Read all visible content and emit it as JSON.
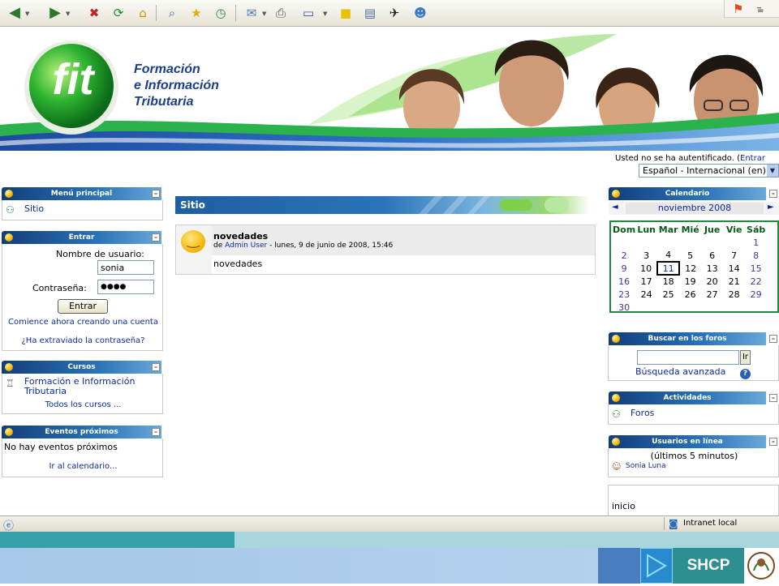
{
  "toolbar": {
    "icons": [
      "back-icon",
      "forward-icon",
      "stop-icon",
      "refresh-icon",
      "home-icon",
      "search-icon",
      "favorites-icon",
      "history-icon",
      "mail-icon",
      "print-icon",
      "edit-icon",
      "discuss-icon",
      "research-icon",
      "messenger-icon",
      "bluetooth-icon"
    ]
  },
  "banner": {
    "logo_text": "fit",
    "title_lines": [
      "Formación",
      "e Información",
      "Tributaria"
    ]
  },
  "header": {
    "auth_text": "Usted no se ha autentificado. (",
    "auth_link": "Entrar",
    "language": "Español - Internacional (en)"
  },
  "blocks": {
    "menu": {
      "title": "Menú principal",
      "item": "Sitio"
    },
    "login": {
      "title": "Entrar",
      "username_label": "Nombre de usuario:",
      "username_value": "sonia",
      "password_label": "Contraseña:",
      "password_value": "●●●●",
      "submit": "Entrar",
      "signup": "Comience ahora creando una cuenta",
      "forgot": "¿Ha extraviado la contraseña?"
    },
    "courses": {
      "title": "Cursos",
      "course": "Formación e Información Tributaria",
      "all": "Todos los cursos ..."
    },
    "events": {
      "title": "Eventos próximos",
      "none": "No hay eventos próximos",
      "calendar_link": "Ir al calendario..."
    }
  },
  "main": {
    "section_title": "Sitio",
    "post": {
      "subject": "novedades",
      "by_prefix": "de",
      "author": "Admin User",
      "date": "- lunes, 9 de junio de 2008, 15:46",
      "body": "novedades"
    }
  },
  "calendar": {
    "title": "Calendario",
    "prev": "◄",
    "next": "►",
    "month": "noviembre 2008",
    "days": [
      "Dom",
      "Lun",
      "Mar",
      "Mié",
      "Jue",
      "Vie",
      "Sáb"
    ],
    "weeks": [
      [
        "",
        "",
        "",
        "",
        "",
        "",
        "1"
      ],
      [
        "2",
        "3",
        "4",
        "5",
        "6",
        "7",
        "8"
      ],
      [
        "9",
        "10",
        "11",
        "12",
        "13",
        "14",
        "15"
      ],
      [
        "16",
        "17",
        "18",
        "19",
        "20",
        "21",
        "22"
      ],
      [
        "23",
        "24",
        "25",
        "26",
        "27",
        "28",
        "29"
      ],
      [
        "30",
        "",
        "",
        "",
        "",
        "",
        ""
      ]
    ],
    "today": "11"
  },
  "forum_search": {
    "title": "Buscar en los foros",
    "go": "Ir",
    "advanced": "Búsqueda avanzada"
  },
  "activities": {
    "title": "Actividades",
    "item": "Foros"
  },
  "online_users": {
    "title": "Usuarios en línea",
    "subtitle": "(últimos 5 minutos)",
    "user": "Sonia Luna"
  },
  "footer_block": {
    "text": "inicio"
  },
  "status_bar": {
    "zone": "Intranet local"
  },
  "taskbar": {
    "brand": "SHCP"
  },
  "colors": {
    "accent_green": "#2bb24c",
    "block_blue": "#1e5fa0",
    "link": "#0b2b9c",
    "calendar_border": "#1e8a3a"
  }
}
